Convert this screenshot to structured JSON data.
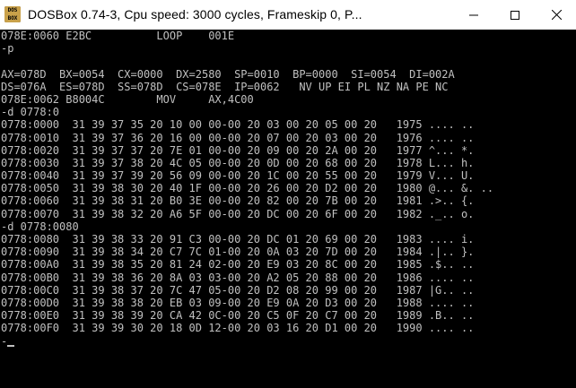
{
  "window": {
    "title": "DOSBox 0.74-3, Cpu speed:      3000 cycles, Frameskip  0, P...",
    "icon_name": "dosbox-icon",
    "icon_text": "DOS BOX"
  },
  "console": {
    "lines": [
      "078E:0060 E2BC          LOOP    001E",
      "-p",
      "",
      "AX=078D  BX=0054  CX=0000  DX=2580  SP=0010  BP=0000  SI=0054  DI=002A",
      "DS=076A  ES=078D  SS=078D  CS=078E  IP=0062   NV UP EI PL NZ NA PE NC",
      "078E:0062 B8004C        MOV     AX,4C00",
      "-d 0778:0",
      "0778:0000  31 39 37 35 20 10 00 00-00 20 03 00 20 05 00 20   1975 .... ..",
      "0778:0010  31 39 37 36 20 16 00 00-00 20 07 00 20 03 00 20   1976 .... ..",
      "0778:0020  31 39 37 37 20 7E 01 00-00 20 09 00 20 2A 00 20   1977 ^... *.",
      "0778:0030  31 39 37 38 20 4C 05 00-00 20 0D 00 20 68 00 20   1978 L... h.",
      "0778:0040  31 39 37 39 20 56 09 00-00 20 1C 00 20 55 00 20   1979 V... U.",
      "0778:0050  31 39 38 30 20 40 1F 00-00 20 26 00 20 D2 00 20   1980 @... &. ..",
      "0778:0060  31 39 38 31 20 B0 3E 00-00 20 82 00 20 7B 00 20   1981 .>.. {.",
      "0778:0070  31 39 38 32 20 A6 5F 00-00 20 DC 00 20 6F 00 20   1982 ._.. o.",
      "-d 0778:0080",
      "0778:0080  31 39 38 33 20 91 C3 00-00 20 DC 01 20 69 00 20   1983 .... i.",
      "0778:0090  31 39 38 34 20 C7 7C 01-00 20 0A 03 20 7D 00 20   1984 .|.. }.",
      "0778:00A0  31 39 38 35 20 81 24 02-00 20 E9 03 20 8C 00 20   1985 .$.. ..",
      "0778:00B0  31 39 38 36 20 8A 03 03-00 20 A2 05 20 88 00 20   1986 .... ..",
      "0778:00C0  31 39 38 37 20 7C 47 05-00 20 D2 08 20 99 00 20   1987 |G.. ..",
      "0778:00D0  31 39 38 38 20 EB 03 09-00 20 E9 0A 20 D3 00 20   1988 .... ..",
      "0778:00E0  31 39 38 39 20 CA 42 0C-00 20 C5 0F 20 C7 00 20   1989 .B.. ..",
      "0778:00F0  31 39 39 30 20 18 0D 12-00 20 03 16 20 D1 00 20   1990 .... ..",
      "-"
    ]
  }
}
